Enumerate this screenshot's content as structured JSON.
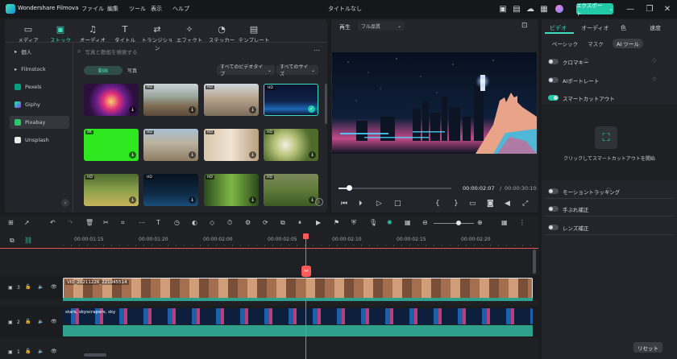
{
  "app": {
    "title": "Wondershare Filmova",
    "window_title": "タイトルなし"
  },
  "menu": [
    "ファイル",
    "編集",
    "ツール",
    "表示",
    "ヘルプ"
  ],
  "export_label": "エクスポート",
  "colors": {
    "accent": "#23c8a6",
    "playhead": "#ff5a5a"
  },
  "media_tabs": [
    {
      "label": "メディア",
      "icon": "media-icon"
    },
    {
      "label": "ストック",
      "icon": "stock-icon",
      "active": true
    },
    {
      "label": "オーディオ",
      "icon": "music-icon"
    },
    {
      "label": "タイトル",
      "icon": "title-icon"
    },
    {
      "label": "トランジション",
      "icon": "transition-icon"
    },
    {
      "label": "エフェクト",
      "icon": "effect-icon"
    },
    {
      "label": "ステッカー",
      "icon": "sticker-icon"
    },
    {
      "label": "テンプレート",
      "icon": "template-icon"
    }
  ],
  "sidebar": {
    "items": [
      {
        "label": "個人"
      },
      {
        "label": "Filmstock"
      },
      {
        "label": "Pexels"
      },
      {
        "label": "Giphy"
      },
      {
        "label": "Pixabay",
        "active": true
      },
      {
        "label": "Unsplash"
      }
    ]
  },
  "search": {
    "placeholder": "写真と動画を検索する"
  },
  "filters": {
    "video": "動画",
    "photo": "写真",
    "type": "すべてのビデオタイプ",
    "size": "すべてのサイズ"
  },
  "thumbs": [
    {
      "badge": "",
      "theme": "portal"
    },
    {
      "badge": "HD",
      "theme": "arena"
    },
    {
      "badge": "HD",
      "theme": "town"
    },
    {
      "badge": "HD",
      "theme": "city-night",
      "selected": true
    },
    {
      "badge": "4K",
      "theme": "green"
    },
    {
      "badge": "HD",
      "theme": "village"
    },
    {
      "badge": "HD",
      "theme": "interior"
    },
    {
      "badge": "HD",
      "theme": "flowers"
    },
    {
      "badge": "HD",
      "theme": "field"
    },
    {
      "badge": "HD",
      "theme": "night-lake"
    },
    {
      "badge": "HD",
      "theme": "forest"
    },
    {
      "badge": "HD",
      "theme": "trees"
    }
  ],
  "preview": {
    "label": "再生",
    "quality": "フル品質",
    "current_time": "00:00:02:07",
    "separator": "/",
    "total_time": "00:00:30:10"
  },
  "right_panel": {
    "tabs": [
      "ビデオ",
      "オーディオ",
      "色",
      "速度"
    ],
    "subtabs": [
      "ベーシック",
      "マスク",
      "AI ツール"
    ],
    "toggles_top": [
      {
        "label": "クロマキー",
        "on": false
      },
      {
        "label": "AIポートレート",
        "on": false
      },
      {
        "label": "スマートカットアウト",
        "on": true
      }
    ],
    "cutout_label": "クリックしてスマートカットアウトを開始",
    "toggles_bottom": [
      {
        "label": "モーショントラッキング",
        "on": false
      },
      {
        "label": "手ぶれ補正",
        "on": false
      },
      {
        "label": "レンズ補正",
        "on": false
      }
    ],
    "reset": "リセット"
  },
  "timeline": {
    "ticks": [
      "00:00:01:15",
      "00:00:01:20",
      "00:00:02:00",
      "00:00:02:05",
      "00:00:02:10",
      "00:00:02:15",
      "00:00:02:20"
    ],
    "track1_clip": "VID_20211226_221045514",
    "track2_clip": "stars, skyscrapers, sky",
    "track1_num": "3",
    "track2_num": "2",
    "track3_num": "1"
  }
}
